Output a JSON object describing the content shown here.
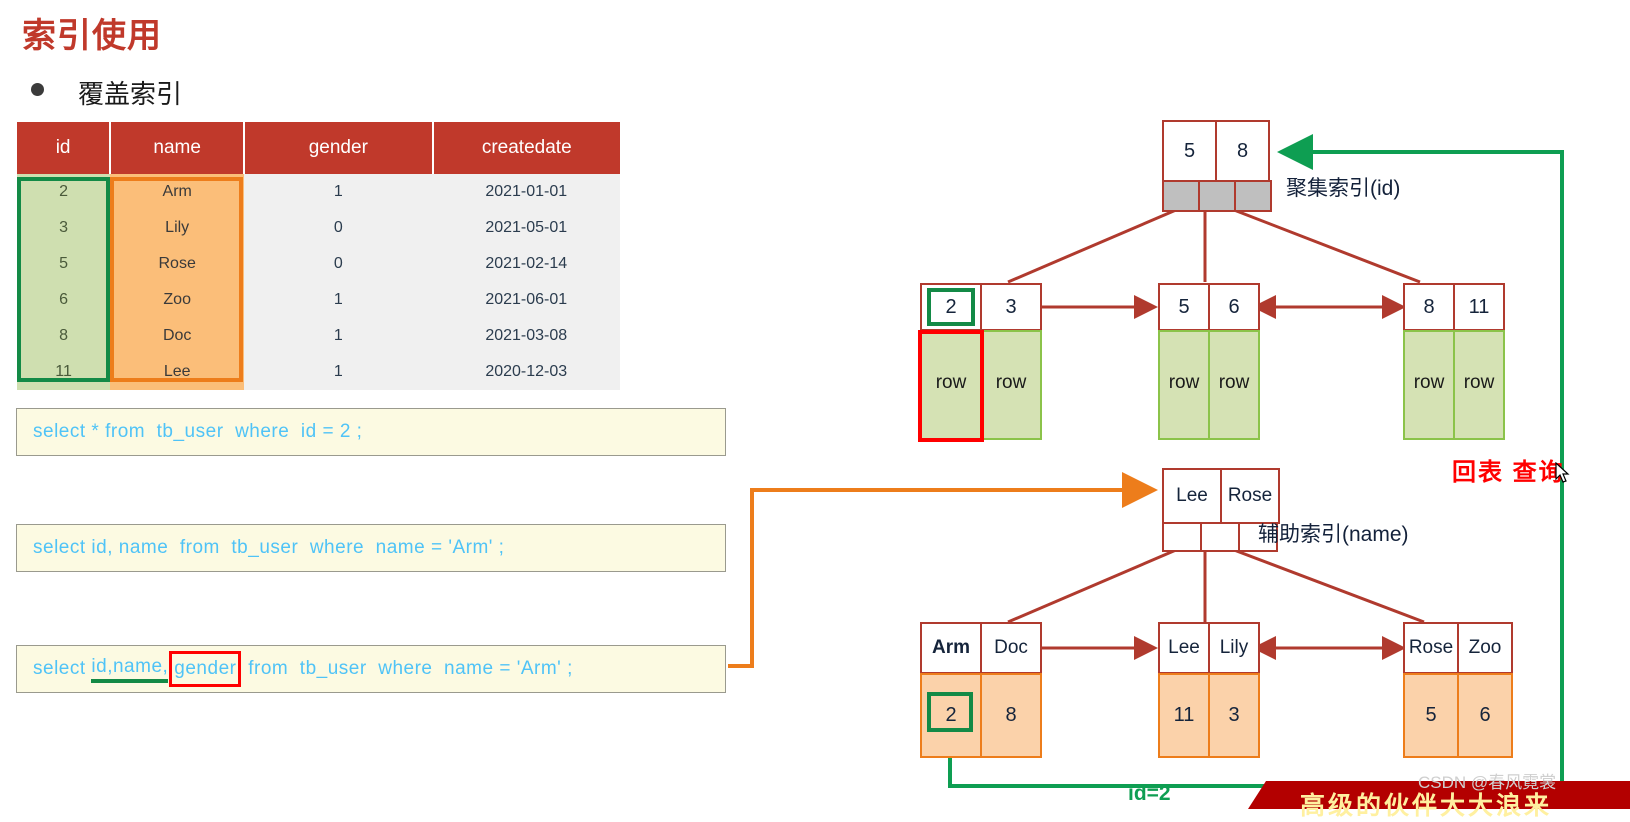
{
  "page": {
    "title": "索引使用",
    "bullet": "覆盖索引",
    "watermark": "CSDN @春风霓裳",
    "banner_text": "高级的伙伴大大浪来",
    "back_to_table_label": "回表 查询",
    "id_eq_label": "id=2"
  },
  "table": {
    "headers": [
      "id",
      "name",
      "gender",
      "createdate"
    ],
    "rows": [
      {
        "id": "2",
        "name": "Arm",
        "gender": "1",
        "createdate": "2021-01-01"
      },
      {
        "id": "3",
        "name": "Lily",
        "gender": "0",
        "createdate": "2021-05-01"
      },
      {
        "id": "5",
        "name": "Rose",
        "gender": "0",
        "createdate": "2021-02-14"
      },
      {
        "id": "6",
        "name": "Zoo",
        "gender": "1",
        "createdate": "2021-06-01"
      },
      {
        "id": "8",
        "name": "Doc",
        "gender": "1",
        "createdate": "2021-03-08"
      },
      {
        "id": "11",
        "name": "Lee",
        "gender": "1",
        "createdate": "2020-12-03"
      }
    ]
  },
  "sql": {
    "stmt1": "select * from  tb_user  where  id = 2 ;",
    "stmt2": "select id, name  from  tb_user  where  name = 'Arm' ;",
    "stmt3_prefix": "select ",
    "stmt3_green": "id,name,",
    "stmt3_boxed": "gender",
    "stmt3_suffix": " from  tb_user  where  name = 'Arm' ;"
  },
  "clustered_index": {
    "label": "聚集索引(id)",
    "root": [
      "5",
      "8"
    ],
    "leaves": [
      {
        "keys": [
          "2",
          "3"
        ],
        "values": [
          "row",
          "row"
        ]
      },
      {
        "keys": [
          "5",
          "6"
        ],
        "values": [
          "row",
          "row"
        ]
      },
      {
        "keys": [
          "8",
          "11"
        ],
        "values": [
          "row",
          "row"
        ]
      }
    ]
  },
  "secondary_index": {
    "label": "辅助索引(name)",
    "root": [
      "Lee",
      "Rose"
    ],
    "leaves": [
      {
        "keys": [
          "Arm",
          "Doc"
        ],
        "values": [
          "2",
          "8"
        ]
      },
      {
        "keys": [
          "Lee",
          "Lily"
        ],
        "values": [
          "11",
          "3"
        ]
      },
      {
        "keys": [
          "Rose",
          "Zoo"
        ],
        "values": [
          "5",
          "6"
        ]
      }
    ]
  },
  "colors": {
    "title_red": "#C0392B",
    "node_border": "#B03A2E",
    "green_highlight": "#138a46",
    "orange_highlight": "#ED7D1B",
    "row_green": "#D5E2B4",
    "id_orange": "#FBD2AA",
    "sql_text": "#4FC3F7",
    "sql_bg": "#FCFAE2"
  }
}
